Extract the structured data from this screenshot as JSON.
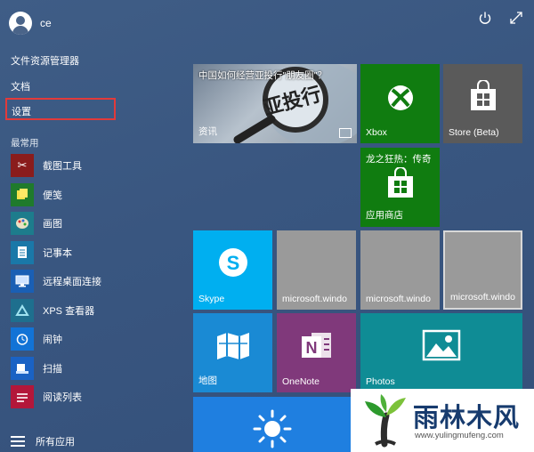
{
  "user": {
    "name": "ce"
  },
  "links": {
    "file_explorer": "文件资源管理器",
    "documents": "文档",
    "settings": "设置"
  },
  "most_used": {
    "heading": "最常用",
    "apps": [
      {
        "label": "截图工具",
        "icon": "snipping-tool-icon",
        "color": "#8a1c1c"
      },
      {
        "label": "便笺",
        "icon": "sticky-notes-icon",
        "color": "#1f7a2c"
      },
      {
        "label": "画图",
        "icon": "paint-icon",
        "color": "#1d7c8c"
      },
      {
        "label": "记事本",
        "icon": "notepad-icon",
        "color": "#1a78a8"
      },
      {
        "label": "远程桌面连接",
        "icon": "remote-desktop-icon",
        "color": "#1a5fb4"
      },
      {
        "label": "XPS 查看器",
        "icon": "xps-viewer-icon",
        "color": "#1e6f8e"
      },
      {
        "label": "闹钟",
        "icon": "alarm-icon",
        "color": "#1273d6"
      },
      {
        "label": "扫描",
        "icon": "scan-icon",
        "color": "#1a62c4"
      },
      {
        "label": "阅读列表",
        "icon": "reading-list-icon",
        "color": "#b3173a"
      }
    ]
  },
  "all_apps": {
    "label": "所有应用"
  },
  "tiles": {
    "news": {
      "headline": "中国如何经营亚投行\"朋友圈\"？",
      "label": "资讯",
      "photo_text": "亚投行"
    },
    "xbox": {
      "label": "Xbox",
      "color": "#107c10"
    },
    "store_beta": {
      "label": "Store (Beta)",
      "color": "#5a5a5a"
    },
    "store_promo": {
      "title": "龙之狂热：传奇",
      "label": "应用商店",
      "color": "#107c10"
    },
    "skype": {
      "label": "Skype",
      "color": "#00aff0"
    },
    "ms1": {
      "label": "microsoft.windo",
      "color": "#9a9a9a"
    },
    "ms2": {
      "label": "microsoft.windo",
      "color": "#9a9a9a"
    },
    "ms3": {
      "label": "microsoft.windo",
      "color": "#9a9a9a"
    },
    "maps": {
      "label": "地图",
      "color": "#1a8ad4"
    },
    "onenote": {
      "label": "OneNote",
      "color": "#80397b"
    },
    "photos": {
      "label": "Photos",
      "color": "#0f8c95"
    },
    "weather": {
      "color": "#1f7fe0"
    }
  },
  "watermark": {
    "title": "雨林木风",
    "url": "www.yulingmufeng.com"
  }
}
